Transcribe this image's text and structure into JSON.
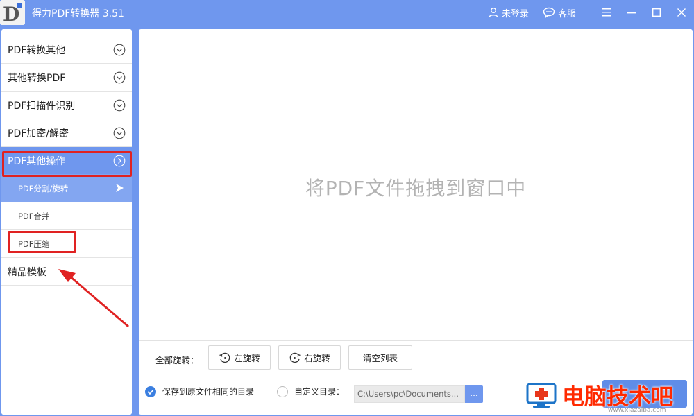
{
  "app": {
    "title": "得力PDF转换器 3.51",
    "login_label": "未登录",
    "service_label": "客服"
  },
  "sidebar": {
    "items": [
      {
        "label": "PDF转换其他"
      },
      {
        "label": "其他转换PDF"
      },
      {
        "label": "PDF扫描件识别"
      },
      {
        "label": "PDF加密/解密"
      },
      {
        "label": "PDF其他操作"
      }
    ],
    "sub_items": [
      {
        "label": "PDF分割/旋转"
      },
      {
        "label": "PDF合并"
      },
      {
        "label": "PDF压缩"
      }
    ],
    "template_label": "精品模板"
  },
  "main": {
    "drop_hint": "将PDF文件拖拽到窗口中",
    "rotate_all_label": "全部旋转：",
    "rotate_left_label": "左旋转",
    "rotate_right_label": "右旋转",
    "clear_list_label": "清空列表",
    "save_same_dir_label": "保存到原文件相同的目录",
    "custom_dir_label": "自定义目录：",
    "custom_dir_path": "C:\\Users\\pc\\Documents...",
    "browse_label": "..."
  },
  "watermark": {
    "text": "电脑技术吧",
    "url": "www.xiazaiba.com"
  },
  "colors": {
    "brand": "#6f97ee",
    "selected_sub": "#83a6f1",
    "annotation_red": "#e02222",
    "watermark_red": "#ff2a00"
  }
}
